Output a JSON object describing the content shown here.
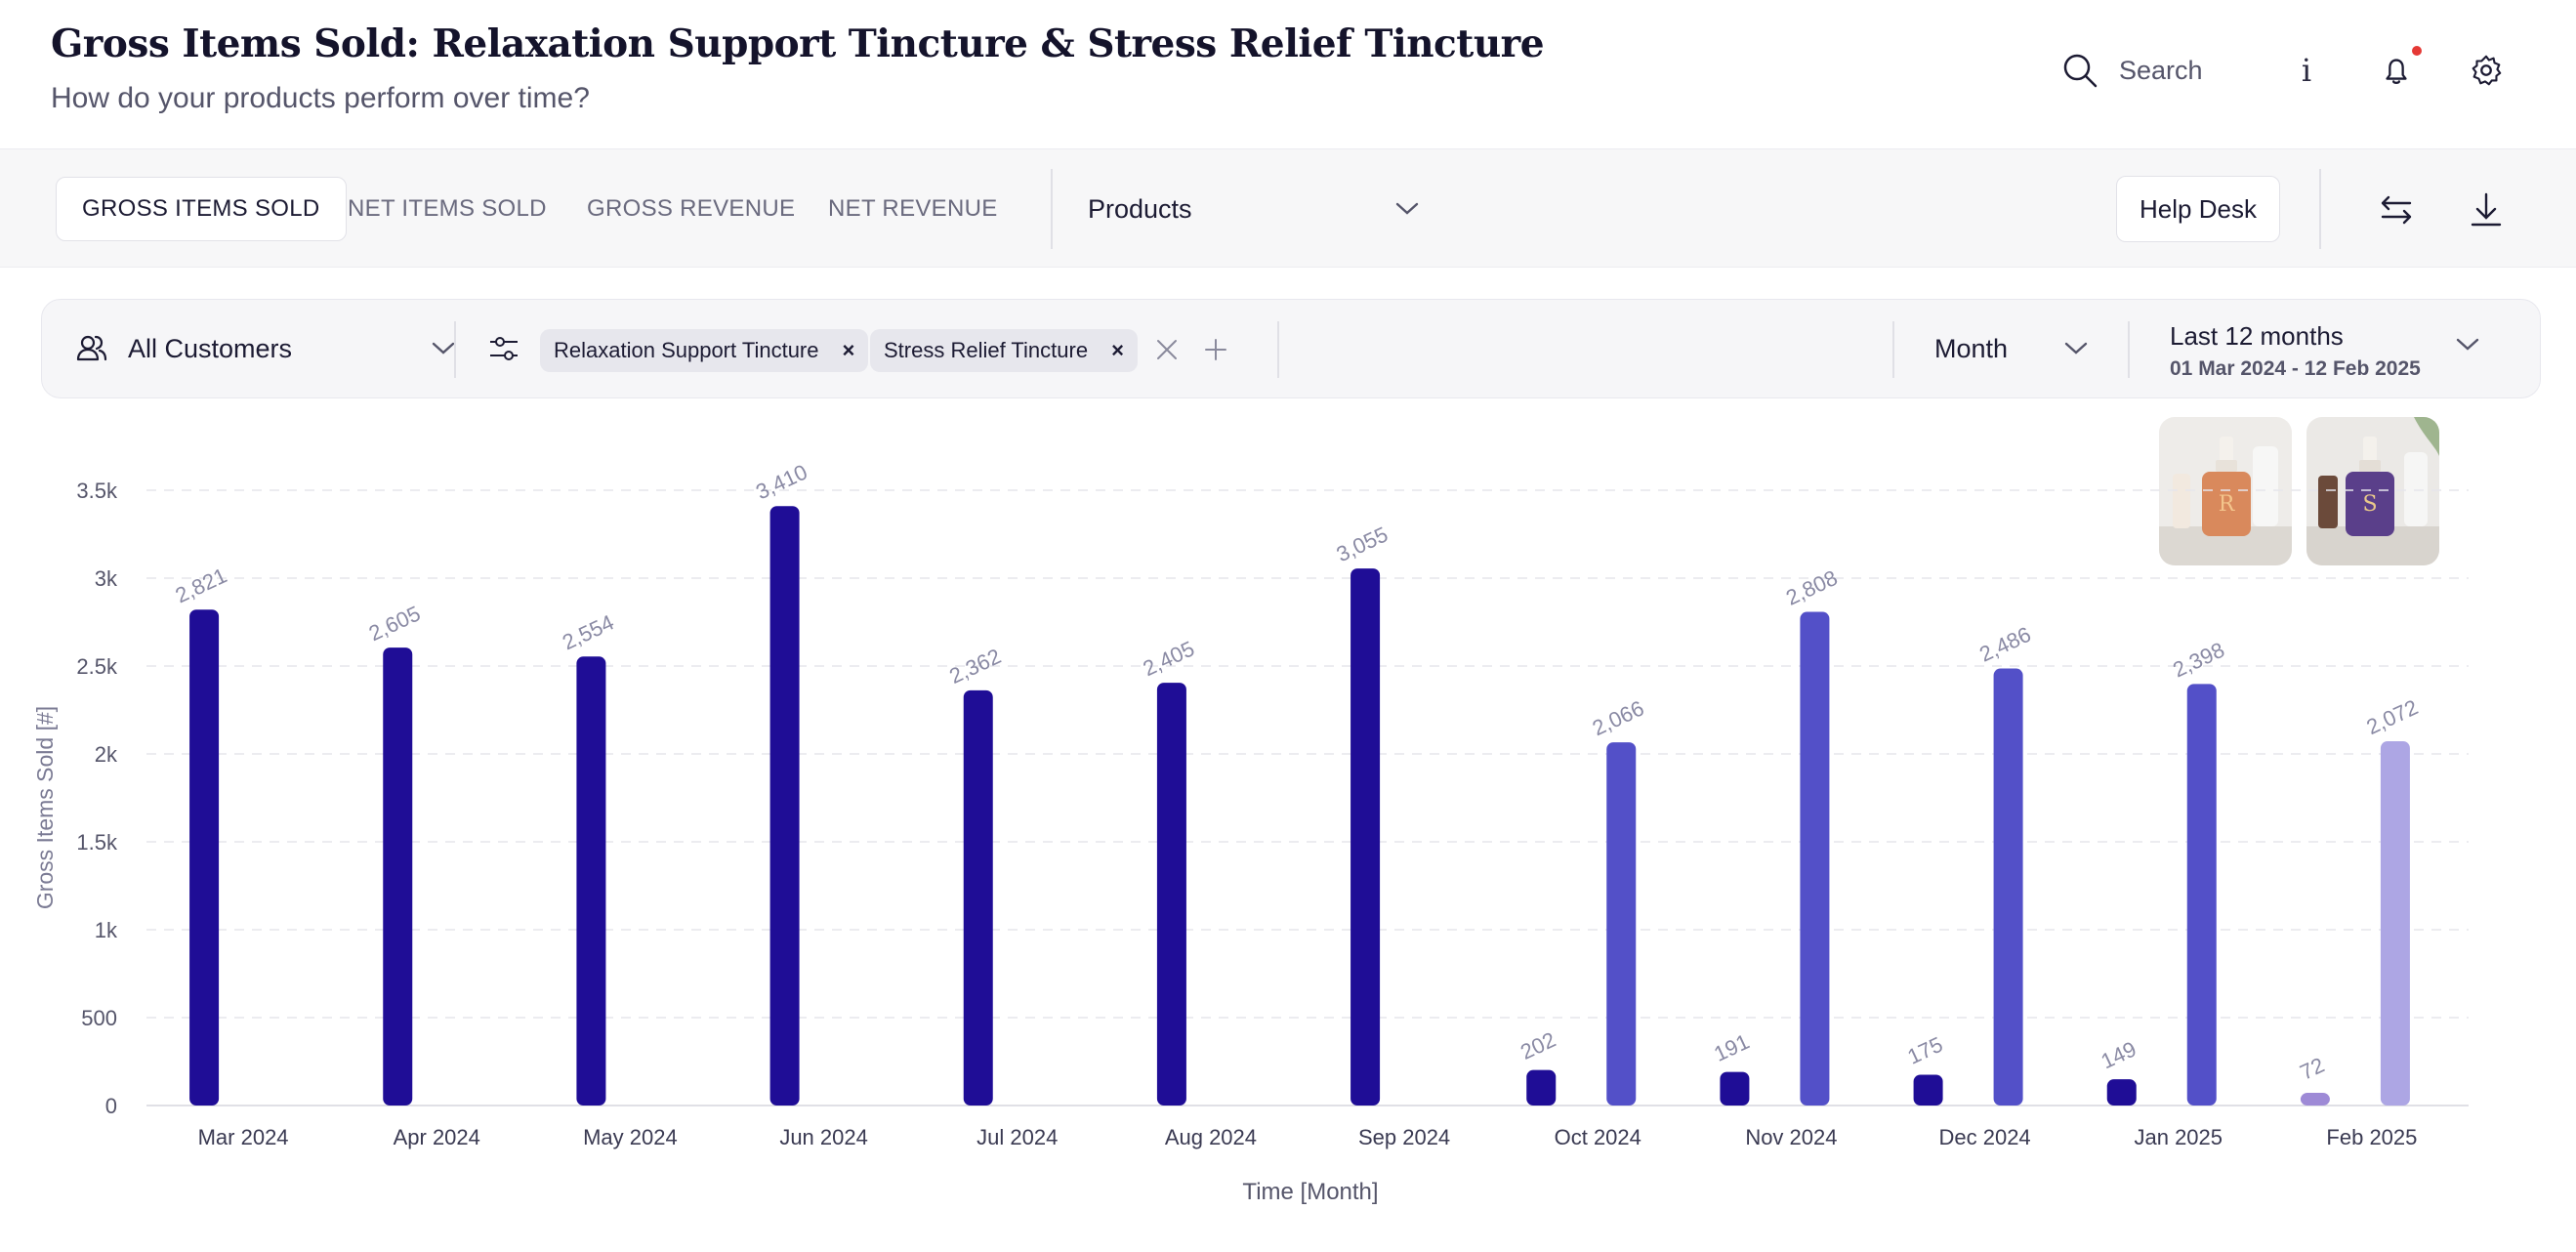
{
  "header": {
    "title": "Gross Items Sold: Relaxation Support Tincture & Stress Relief Tincture",
    "subtitle": "How do your products perform over time?",
    "search_label": "Search"
  },
  "toolbar": {
    "tabs": [
      {
        "label": "GROSS ITEMS SOLD",
        "active": true
      },
      {
        "label": "NET ITEMS SOLD",
        "active": false
      },
      {
        "label": "GROSS REVENUE",
        "active": false
      },
      {
        "label": "NET REVENUE",
        "active": false
      }
    ],
    "products_label": "Products",
    "help_label": "Help Desk"
  },
  "filters": {
    "customers": "All Customers",
    "chips": [
      "Relaxation Support Tincture",
      "Stress Relief Tincture"
    ],
    "period": "Month",
    "range_label": "Last 12 months",
    "range_dates": "01 Mar 2024 - 12 Feb 2025"
  },
  "colors": {
    "series_dark": "#1f0d96",
    "series_light": "#5350c8",
    "partial_light": "#ada6e4",
    "partial_dark": "#9e8ad6",
    "accent_dot": "#e53935"
  },
  "chart_data": {
    "type": "bar",
    "xlabel": "Time [Month]",
    "ylabel": "Gross Items Sold [#]",
    "ylim": [
      0,
      3500
    ],
    "yticks": [
      0,
      500,
      1000,
      1500,
      2000,
      2500,
      3000,
      3500
    ],
    "ytick_labels": [
      "0",
      "500",
      "1k",
      "1.5k",
      "2k",
      "2.5k",
      "3k",
      "3.5k"
    ],
    "grid": true,
    "categories": [
      "Mar 2024",
      "Apr 2024",
      "May 2024",
      "Jun 2024",
      "Jul 2024",
      "Aug 2024",
      "Sep 2024",
      "Oct 2024",
      "Nov 2024",
      "Dec 2024",
      "Jan 2025",
      "Feb 2025"
    ],
    "series": [
      {
        "values": [
          2821,
          2605,
          2554,
          3410,
          2362,
          2405,
          3055,
          202,
          191,
          175,
          149,
          72
        ],
        "labels": [
          "2,821",
          "2,605",
          "2,554",
          "3,410",
          "2,362",
          "2,405",
          "3,055",
          "202",
          "191",
          "175",
          "149",
          "72"
        ]
      },
      {
        "values": [
          null,
          null,
          null,
          null,
          null,
          null,
          null,
          2066,
          2808,
          2486,
          2398,
          2072
        ],
        "labels": [
          "",
          "",
          "",
          "",
          "",
          "",
          "",
          "2,066",
          "2,808",
          "2,486",
          "2,398",
          "2,072"
        ]
      }
    ]
  }
}
